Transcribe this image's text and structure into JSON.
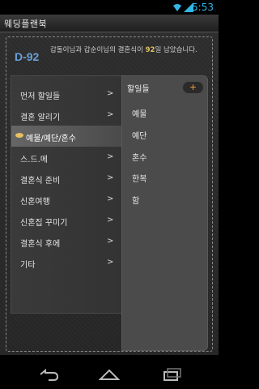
{
  "status": {
    "time": "5:53"
  },
  "app": {
    "title": "웨딩플랜북"
  },
  "dday": {
    "label": "D-92",
    "notice_prefix": "갑돌이님과 갑순이님의 결혼식이 ",
    "notice_number": "92",
    "notice_suffix": "일 남았습니다."
  },
  "menu": {
    "items": [
      {
        "label": "먼저 할일들",
        "arrow": ">"
      },
      {
        "label": "결혼 알리기",
        "arrow": ">"
      },
      {
        "label": "예물/예단/혼수",
        "arrow": ""
      },
      {
        "label": "스.드.메",
        "arrow": ">"
      },
      {
        "label": "결혼식 준비",
        "arrow": ">"
      },
      {
        "label": "신혼여행",
        "arrow": ">"
      },
      {
        "label": "신혼집 꾸미기",
        "arrow": ">"
      },
      {
        "label": "결혼식 후에",
        "arrow": ">"
      },
      {
        "label": "기타",
        "arrow": ">"
      }
    ]
  },
  "submenu": {
    "header": "할일들",
    "add_label": "+",
    "items": [
      "예물",
      "예단",
      "혼수",
      "한복",
      "함"
    ]
  },
  "colors": {
    "accent": "#33b5e5",
    "dday": "#6aa0d8",
    "ring": "#e8c060",
    "add": "#f0a040"
  },
  "icons": {
    "wifi": "wifi-icon",
    "signal": "signal-icon",
    "back": "back-icon",
    "home": "home-icon",
    "recents": "recents-icon",
    "ring": "ring-icon"
  }
}
